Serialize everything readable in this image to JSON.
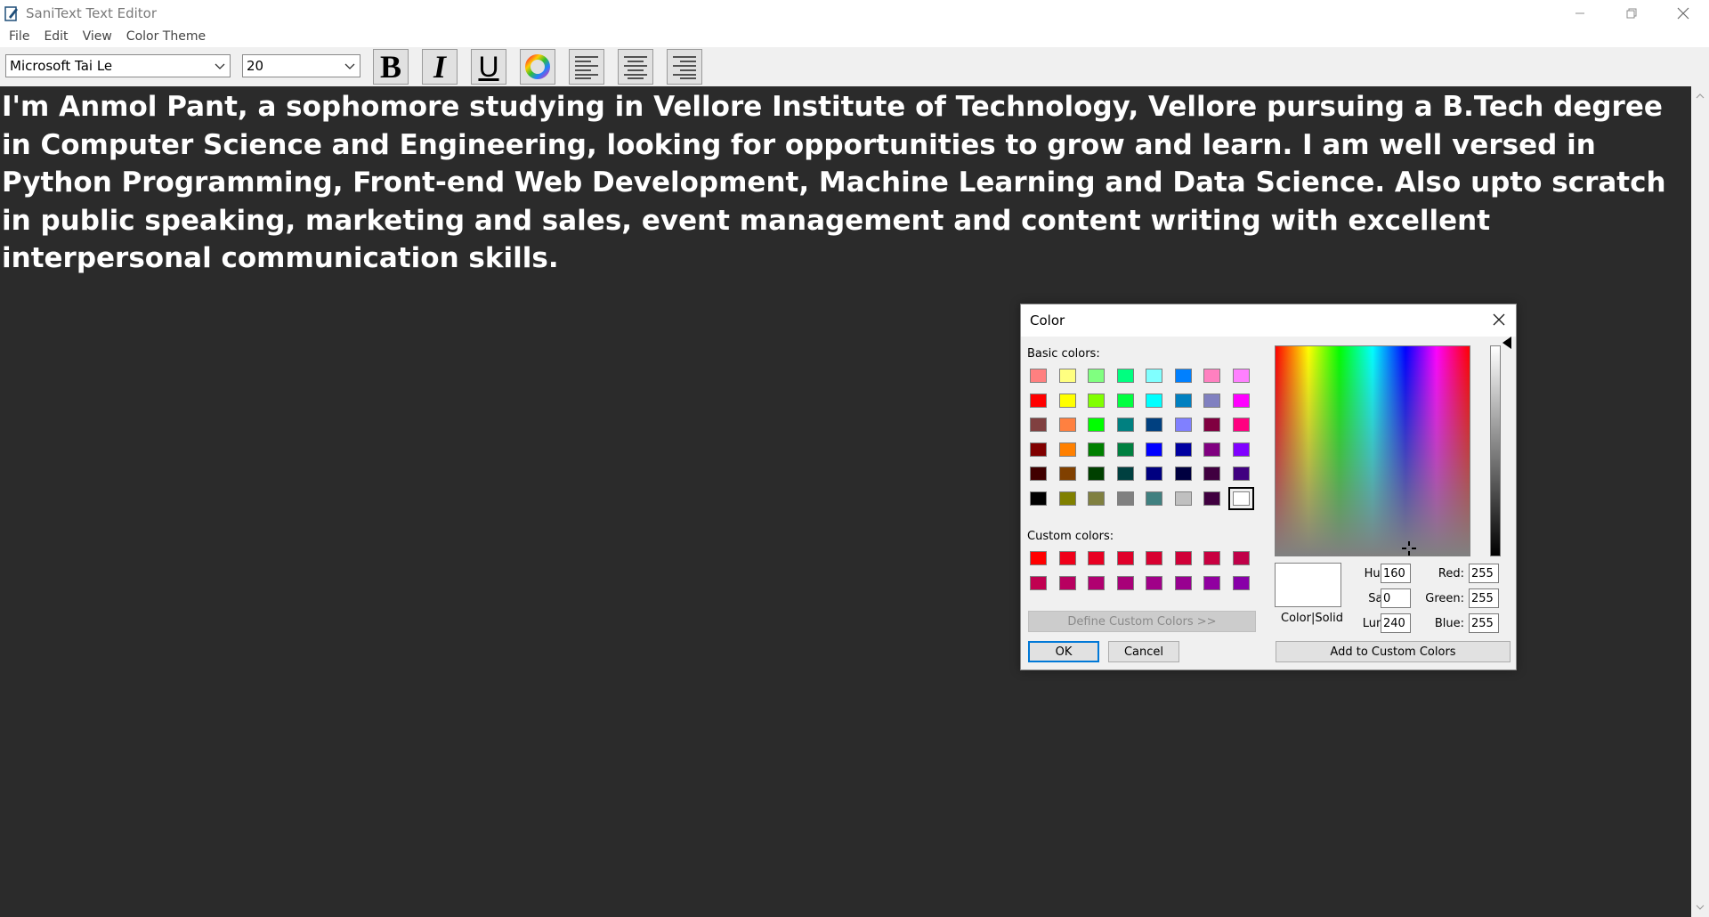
{
  "window": {
    "title": "SaniText Text Editor",
    "controls": [
      "minimize",
      "restore",
      "close"
    ]
  },
  "menu": [
    "File",
    "Edit",
    "View",
    "Color Theme"
  ],
  "toolbar": {
    "font_family": "Microsoft Tai Le",
    "font_size": "20",
    "bold_label": "B",
    "italic_label": "I",
    "underline_label": "U",
    "color_icon": "color-wheel-icon",
    "align_buttons": [
      "align-left-icon",
      "align-center-icon",
      "align-right-icon"
    ]
  },
  "editor": {
    "background": "#2b2b2b",
    "text_color": "#ffffff",
    "content": "I'm Anmol Pant, a sophomore studying in Vellore Institute of Technology, Vellore pursuing a B.Tech degree in Computer Science and Engineering, looking for opportunities to grow and learn. I am well versed in Python Programming, Front-end Web Development, Machine Learning and Data Science. Also upto scratch in public speaking, marketing and sales, event management and content writing with excellent interpersonal communication skills."
  },
  "color_dialog": {
    "title": "Color",
    "basic_colors_label": "Basic colors:",
    "basic_colors": [
      [
        "#ff8080",
        "#ffff80",
        "#80ff80",
        "#00ff80",
        "#80ffff",
        "#0080ff",
        "#ff80c0",
        "#ff80ff"
      ],
      [
        "#ff0000",
        "#ffff00",
        "#80ff00",
        "#00ff40",
        "#00ffff",
        "#0080c0",
        "#8080c0",
        "#ff00ff"
      ],
      [
        "#804040",
        "#ff8040",
        "#00ff00",
        "#008080",
        "#004080",
        "#8080ff",
        "#800040",
        "#ff0080"
      ],
      [
        "#800000",
        "#ff8000",
        "#008000",
        "#008040",
        "#0000ff",
        "#0000a0",
        "#800080",
        "#8000ff"
      ],
      [
        "#400000",
        "#804000",
        "#004000",
        "#004040",
        "#000080",
        "#000040",
        "#400040",
        "#400080"
      ],
      [
        "#000000",
        "#808000",
        "#808040",
        "#808080",
        "#408080",
        "#c0c0c0",
        "#400040",
        "#ffffff"
      ]
    ],
    "selected_basic": [
      5,
      7
    ],
    "custom_colors_label": "Custom colors:",
    "custom_colors": [
      [
        "#ff0000",
        "#f0001a",
        "#e80022",
        "#e0002a",
        "#d80030",
        "#d00038",
        "#c80040",
        "#c00048"
      ],
      [
        "#c00050",
        "#b80060",
        "#b00070",
        "#a80078",
        "#a00088",
        "#980090",
        "#9000a0",
        "#8800a8"
      ]
    ],
    "define_custom_label": "Define Custom Colors >>",
    "ok_label": "OK",
    "cancel_label": "Cancel",
    "preview_label": "Color|Solid",
    "hue_label": "Hue:",
    "sat_label": "Sat:",
    "lum_label": "Lum:",
    "red_label": "Red:",
    "green_label": "Green:",
    "blue_label": "Blue:",
    "hue": "160",
    "sat": "0",
    "lum": "240",
    "red": "255",
    "green": "255",
    "blue": "255",
    "add_custom_label": "Add to Custom Colors"
  }
}
